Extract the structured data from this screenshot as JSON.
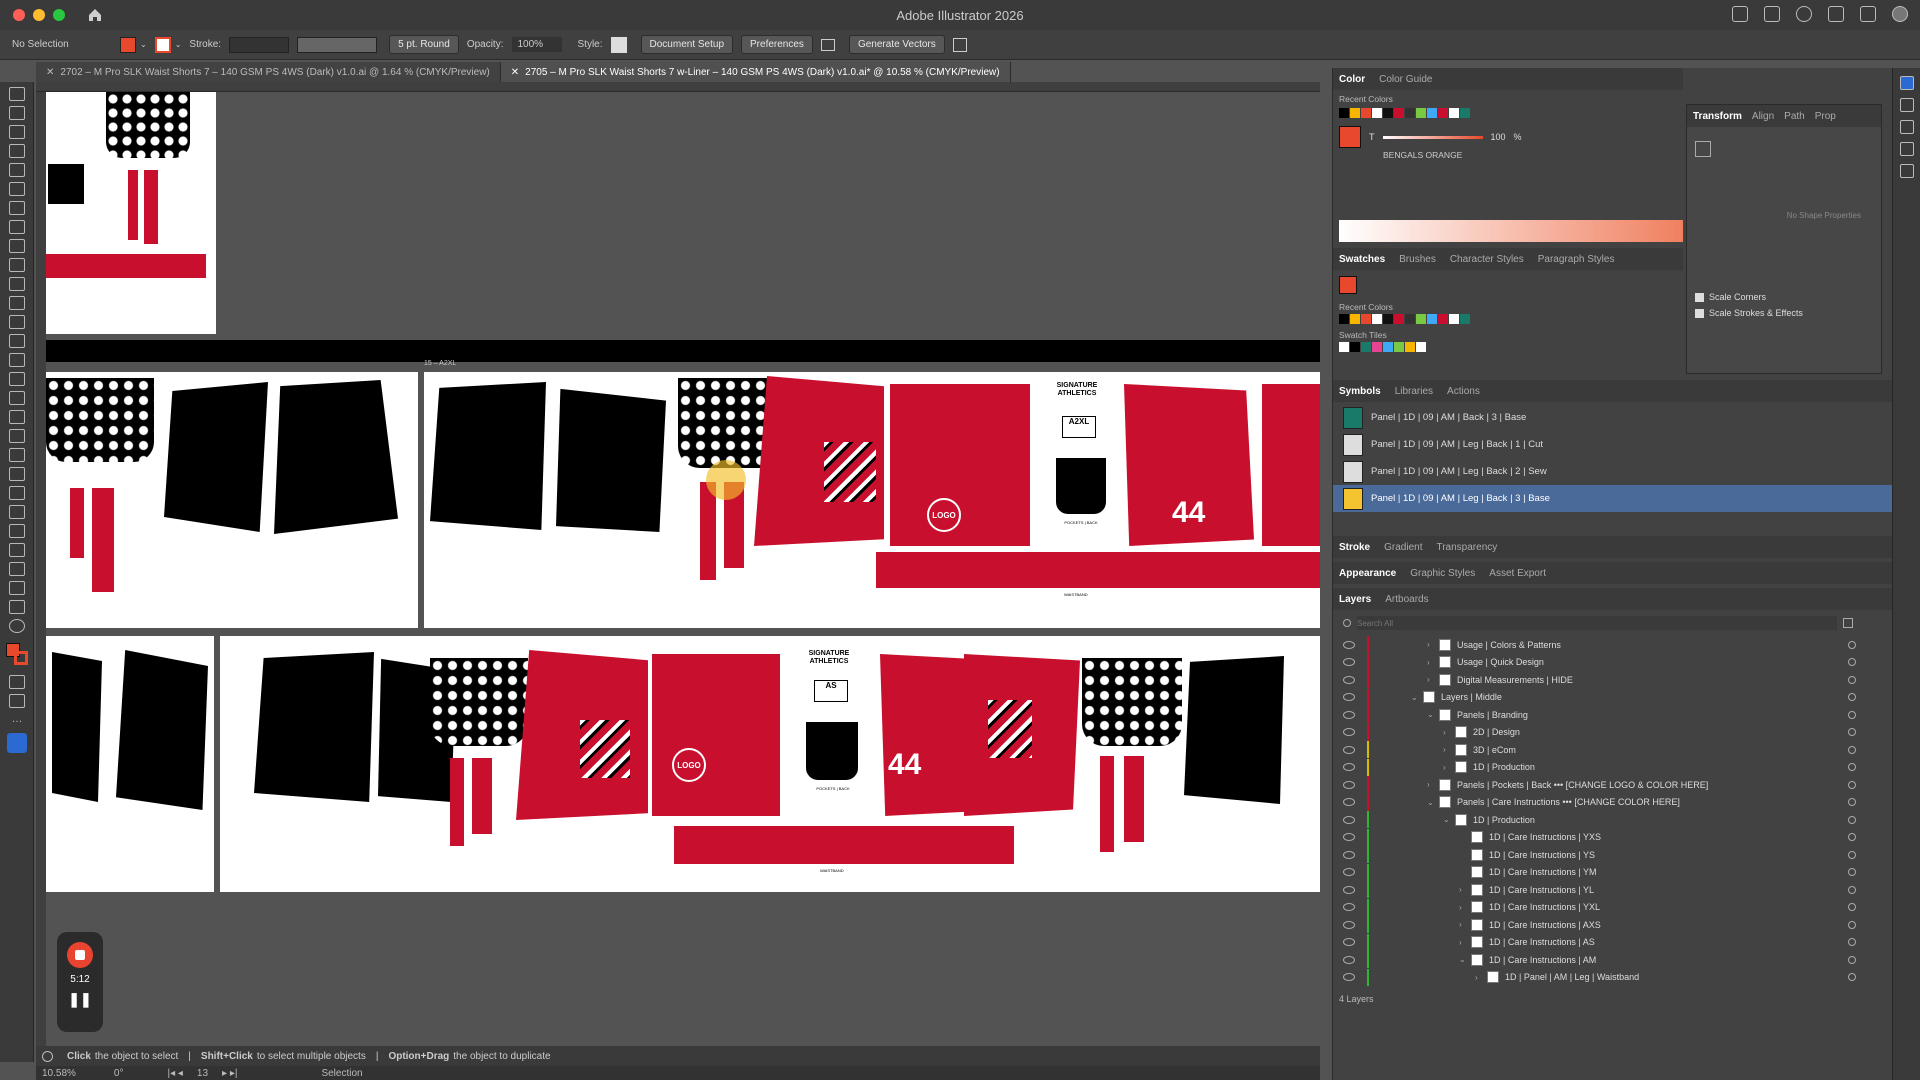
{
  "window": {
    "title": "Adobe Illustrator 2026",
    "traffic": [
      "#ff5f57",
      "#febc2e",
      "#28c840"
    ]
  },
  "controlbar": {
    "selection": "No Selection",
    "stroke_label": "Stroke:",
    "brush": "5 pt. Round",
    "opacity_label": "Opacity:",
    "opacity_value": "100%",
    "style_label": "Style:",
    "document_setup": "Document Setup",
    "preferences": "Preferences",
    "generate_vectors": "Generate Vectors",
    "fill_color": "#e8482b"
  },
  "tabs": [
    {
      "label": "2702 – M Pro SLK Waist Shorts 7 – 140 GSM PS 4WS (Dark) v1.0.ai @ 1.64 % (CMYK/Preview)"
    },
    {
      "label": "2705 – M Pro SLK Waist Shorts 7 w-Liner – 140 GSM PS 4WS (Dark) v1.0.ai* @ 10.58 % (CMYK/Preview)"
    }
  ],
  "artwork": {
    "brand": "SIGNATURE ATHLETICS",
    "size_a": "A2XL",
    "size_b": "AS",
    "number": "44",
    "logo": "LOGO",
    "pocket_back": "POCKETS | BACK",
    "waistband": "WAISTBAND",
    "artboard_label": "15 – A2XL",
    "red": "#c8102e",
    "black": "#000000"
  },
  "status": {
    "hint_1": "Click",
    "hint_1b": "the object to select",
    "hint_2": "Shift+Click",
    "hint_2b": "to select multiple objects",
    "hint_3": "Option+Drag",
    "hint_3b": "the object to duplicate",
    "zoom": "10.58%",
    "rotation": "0°",
    "artboard_num": "13",
    "tool": "Selection"
  },
  "recorder": {
    "time": "5:12"
  },
  "color_panel": {
    "tabs": [
      "Color",
      "Color Guide"
    ],
    "recent_colors_label": "Recent Colors",
    "tint_label": "T",
    "tint_value": "100",
    "tint_unit": "%",
    "swatch_name": "BENGALS ORANGE"
  },
  "transform_panel": {
    "tabs": [
      "Transform",
      "Align",
      "Path",
      "Prop"
    ],
    "no_shape": "No Shape Properties",
    "scale_corners": "Scale Corners",
    "scale_strokes": "Scale Strokes & Effects"
  },
  "swatches_panel": {
    "tabs": [
      "Swatches",
      "Brushes",
      "Character Styles",
      "Paragraph Styles"
    ],
    "recent_colors_label": "Recent Colors",
    "swatch_tiles_label": "Swatch Tiles"
  },
  "symbols_panel": {
    "tabs": [
      "Symbols",
      "Libraries",
      "Actions"
    ],
    "items": [
      {
        "label": "Panel | 1D | 09 | AM | Back | 3 | Base",
        "thumb": "#1a7a6a"
      },
      {
        "label": "Panel | 1D | 09 | AM | Leg | Back | 1 | Cut",
        "thumb": "#cccccc"
      },
      {
        "label": "Panel | 1D | 09 | AM | Leg | Back | 2 | Sew",
        "thumb": "#cccccc"
      },
      {
        "label": "Panel | 1D | 09 | AM | Leg | Back | 3 | Base",
        "thumb": "#f4c430"
      }
    ]
  },
  "stroke_panel": {
    "tabs": [
      "Stroke",
      "Gradient",
      "Transparency"
    ]
  },
  "appearance_panel": {
    "tabs": [
      "Appearance",
      "Graphic Styles",
      "Asset Export"
    ]
  },
  "layers_panel": {
    "tabs": [
      "Layers",
      "Artboards"
    ],
    "search_placeholder": "Search All",
    "count": "4 Layers",
    "items": [
      {
        "label": "Usage | Colors & Patterns",
        "indent": 1,
        "tog": "›",
        "bar": "#c8102e"
      },
      {
        "label": "Usage | Quick Design",
        "indent": 1,
        "tog": "›",
        "bar": "#c8102e"
      },
      {
        "label": "Digital Measurements | HIDE",
        "indent": 1,
        "tog": "›",
        "bar": "#c8102e"
      },
      {
        "label": "Layers | Middle",
        "indent": 0,
        "tog": "⌄",
        "bar": "#c8102e"
      },
      {
        "label": "Panels | Branding",
        "indent": 1,
        "tog": "⌄",
        "bar": "#c8102e"
      },
      {
        "label": "2D | Design",
        "indent": 2,
        "tog": "›",
        "bar": "#c8102e"
      },
      {
        "label": "3D | eCom",
        "indent": 2,
        "tog": "›",
        "bar": "#d4c000"
      },
      {
        "label": "1D | Production",
        "indent": 2,
        "tog": "›",
        "bar": "#d4c000"
      },
      {
        "label": "Panels | Pockets | Back  ••• [CHANGE LOGO & COLOR HERE]",
        "indent": 1,
        "tog": "›",
        "bar": "#c8102e"
      },
      {
        "label": "Panels | Care Instructions  ••• [CHANGE COLOR HERE]",
        "indent": 1,
        "tog": "⌄",
        "bar": "#c8102e"
      },
      {
        "label": "1D | Production",
        "indent": 2,
        "tog": "⌄",
        "bar": "#2eb82e"
      },
      {
        "label": "1D | Care Instructions | YXS",
        "indent": 3,
        "tog": "",
        "bar": "#2eb82e"
      },
      {
        "label": "1D | Care Instructions | YS",
        "indent": 3,
        "tog": "",
        "bar": "#2eb82e"
      },
      {
        "label": "1D | Care Instructions | YM",
        "indent": 3,
        "tog": "",
        "bar": "#2eb82e"
      },
      {
        "label": "1D | Care Instructions | YL",
        "indent": 3,
        "tog": "›",
        "bar": "#2eb82e"
      },
      {
        "label": "1D | Care Instructions | YXL",
        "indent": 3,
        "tog": "›",
        "bar": "#2eb82e"
      },
      {
        "label": "1D | Care Instructions | AXS",
        "indent": 3,
        "tog": "›",
        "bar": "#2eb82e"
      },
      {
        "label": "1D | Care Instructions | AS",
        "indent": 3,
        "tog": "›",
        "bar": "#2eb82e"
      },
      {
        "label": "1D | Care Instructions | AM",
        "indent": 3,
        "tog": "⌄",
        "bar": "#2eb82e"
      },
      {
        "label": "1D | Panel | AM | Leg | Waistband",
        "indent": 4,
        "tog": "›",
        "bar": "#2eb82e"
      }
    ]
  }
}
